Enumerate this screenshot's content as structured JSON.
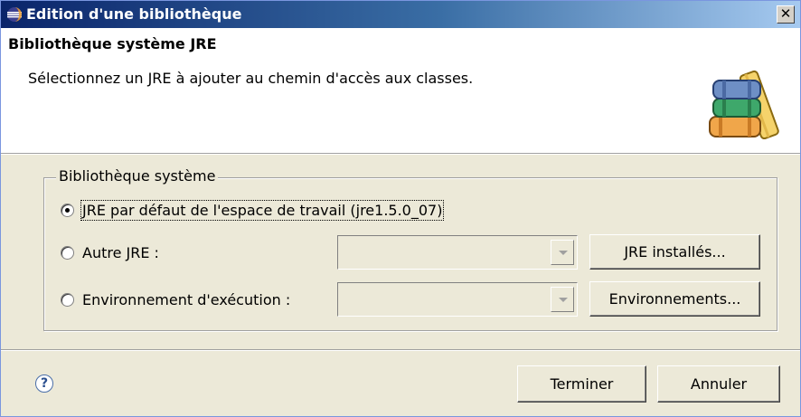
{
  "window": {
    "title": "Edition d'une bibliothèque",
    "close_label": "✕"
  },
  "banner": {
    "title": "Bibliothèque système JRE",
    "description": "Sélectionnez un JRE à ajouter au chemin d'accès aux classes."
  },
  "group": {
    "legend": "Bibliothèque système",
    "options": [
      {
        "label": "JRE par défaut de l'espace de travail (jre1.5.0_07)",
        "selected": true
      },
      {
        "label": "Autre JRE :",
        "selected": false
      },
      {
        "label": "Environnement d'exécution :",
        "selected": false
      }
    ],
    "installed_jres_button": "JRE installés...",
    "environments_button": "Environnements..."
  },
  "footer": {
    "help_icon": "?",
    "finish_button": "Terminer",
    "cancel_button": "Annuler"
  },
  "colors": {
    "titlebar_start": "#0a246a",
    "titlebar_end": "#a6caf0",
    "dialog_bg": "#ece9d8"
  }
}
